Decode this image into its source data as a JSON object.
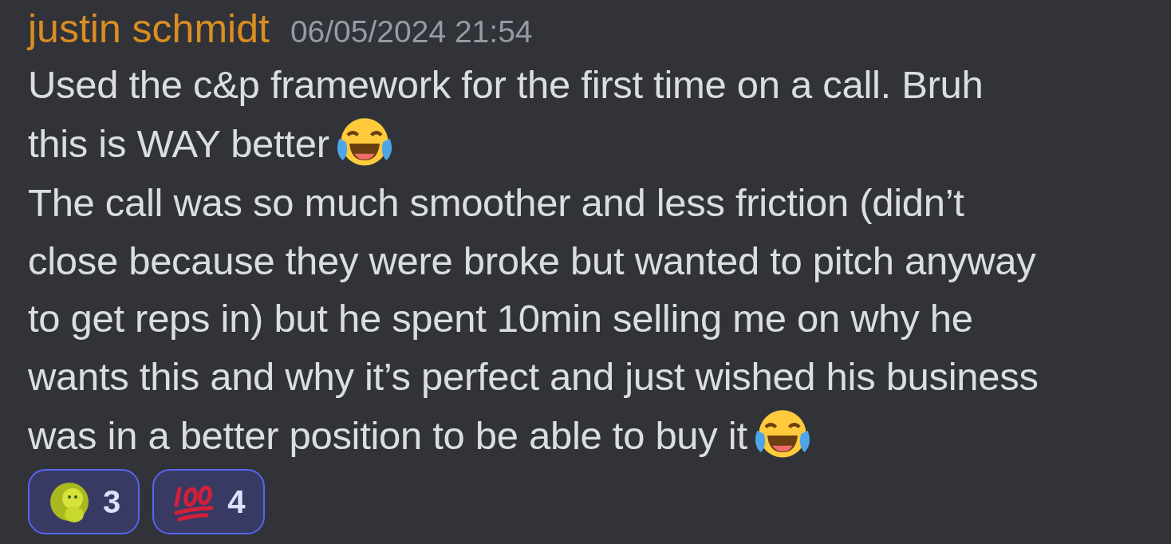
{
  "message": {
    "author": "justin schmidt",
    "timestamp": "06/05/2024 21:54",
    "paragraphs": [
      {
        "lines": [
          "Used the c&p framework for the first time on a call. Bruh",
          "this is WAY better"
        ],
        "kind": "tears-of-joy"
      },
      {
        "lines": [
          "The call was so much smoother and less friction (didn’t",
          "close because they were broke but wanted to pitch anyway",
          "to get reps in) but he spent 10min selling me on why he",
          "wants this and why it’s perfect and just wished his business",
          "was in a better position to be able to buy it"
        ],
        "kind": "tears-of-joy"
      }
    ],
    "reactions": [
      {
        "kind": "lion",
        "count": "3",
        "selected": true
      },
      {
        "kind": "hundred",
        "count": "4",
        "selected": true
      }
    ]
  }
}
